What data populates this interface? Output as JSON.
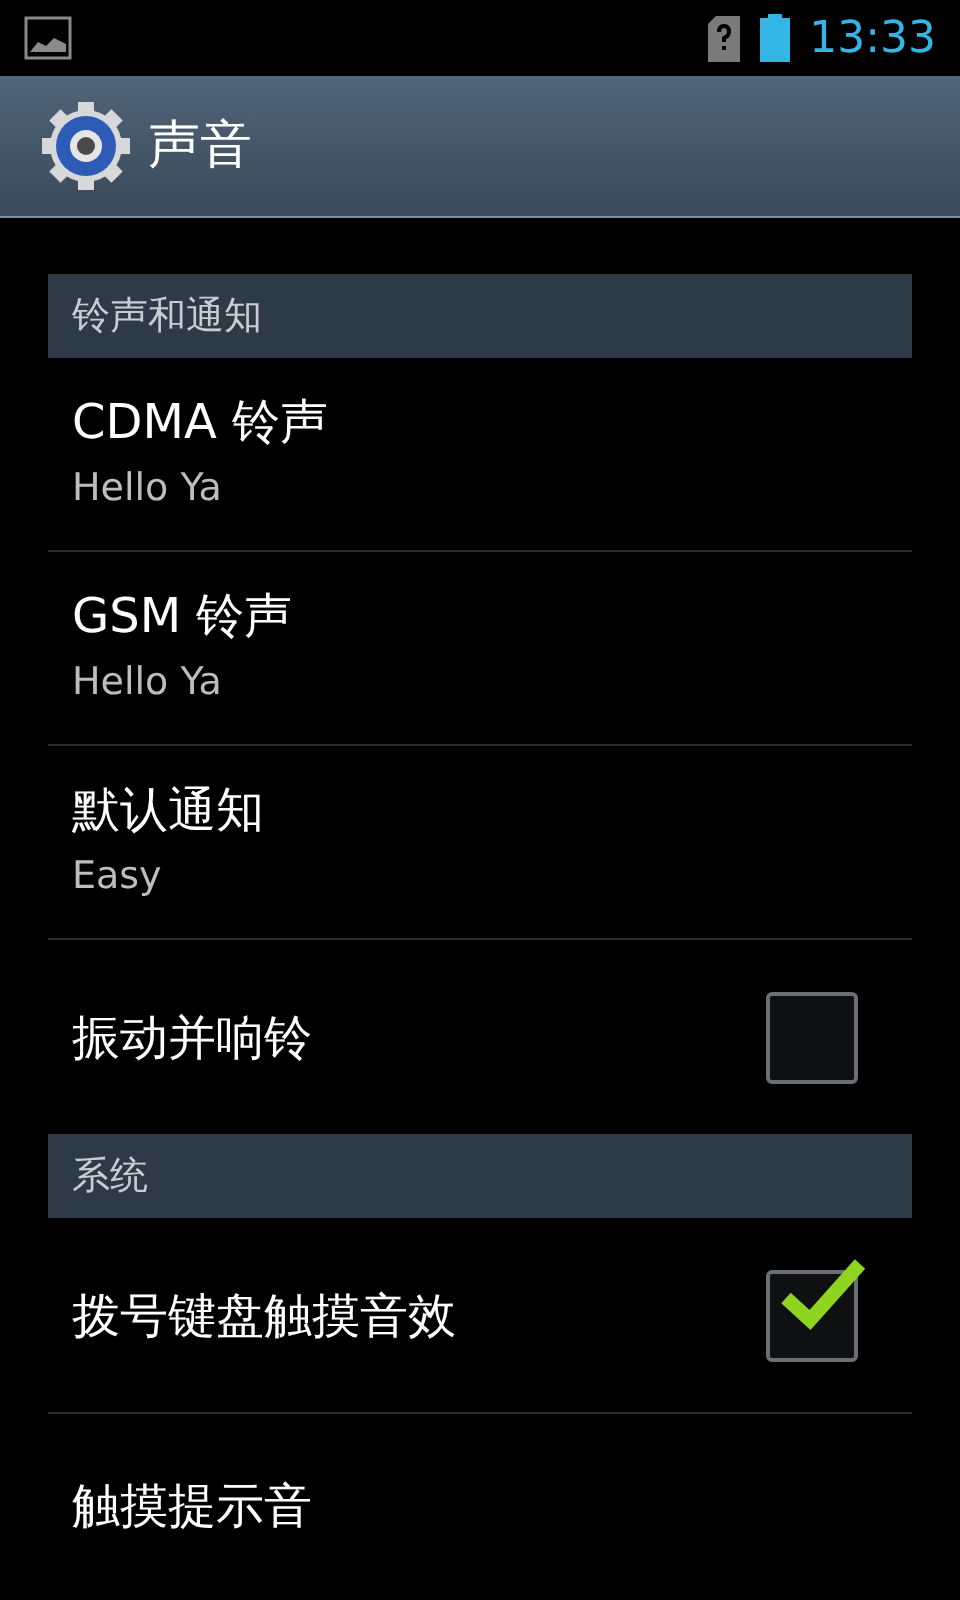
{
  "status_bar": {
    "time": "13:33"
  },
  "header": {
    "title": "声音"
  },
  "sections": [
    {
      "title": "铃声和通知",
      "items": [
        {
          "kind": "summary",
          "title": "CDMA 铃声",
          "summary": "Hello Ya"
        },
        {
          "kind": "summary",
          "title": "GSM 铃声",
          "summary": "Hello Ya"
        },
        {
          "kind": "summary",
          "title": "默认通知",
          "summary": "Easy"
        },
        {
          "kind": "checkbox",
          "title": "振动并响铃",
          "checked": false
        }
      ]
    },
    {
      "title": "系统",
      "items": [
        {
          "kind": "checkbox",
          "title": "拨号键盘触摸音效",
          "checked": true
        },
        {
          "kind": "plain",
          "title": "触摸提示音"
        }
      ]
    }
  ]
}
